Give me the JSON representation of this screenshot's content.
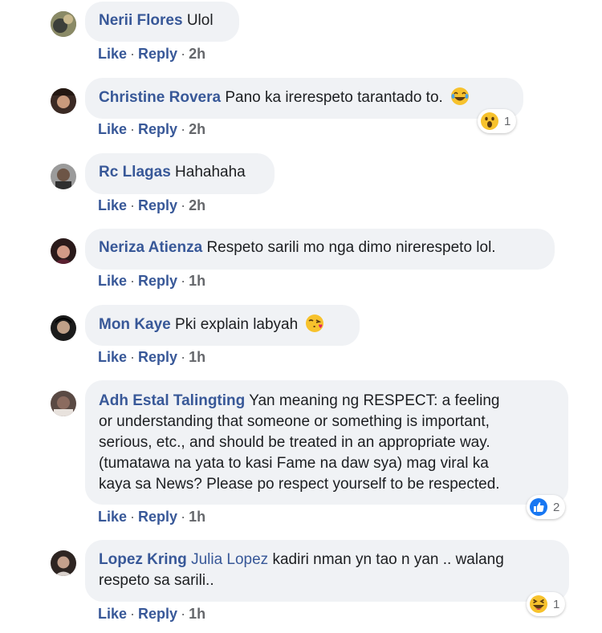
{
  "comments": [
    {
      "author": "Nerii Flores",
      "text": "Ulol",
      "like": "Like",
      "reply": "Reply",
      "time": "2h"
    },
    {
      "author": "Christine Rovera",
      "text": "Pano ka irerespeto tarantado to.",
      "emoji": "laughing-tears-emoji",
      "like": "Like",
      "reply": "Reply",
      "time": "2h",
      "reaction": {
        "icon": "wow-reaction-icon",
        "count": "1"
      }
    },
    {
      "author": "Rc Llagas",
      "text": "Hahahaha",
      "like": "Like",
      "reply": "Reply",
      "time": "2h"
    },
    {
      "author": "Neriza Atienza",
      "text": "Respeto sarili mo nga dimo nirerespeto lol.",
      "like": "Like",
      "reply": "Reply",
      "time": "1h"
    },
    {
      "author": "Mon Kaye",
      "text": "Pki explain labyah",
      "emoji": "kissing-heart-emoji",
      "like": "Like",
      "reply": "Reply",
      "time": "1h"
    },
    {
      "author": "Adh Estal Talingting",
      "text_lines": [
        "Yan meaning ng RESPECT: a feeling",
        "or understanding that someone or something is important,",
        "serious, etc., and should be treated in an appropriate way.",
        "(tumatawa na yata to kasi Fame na daw sya) mag viral ka",
        "kaya sa News? Please po respect yourself to be respected."
      ],
      "like": "Like",
      "reply": "Reply",
      "time": "1h",
      "reaction": {
        "icon": "like-reaction-icon",
        "count": "2"
      }
    },
    {
      "author": "Lopez Kring",
      "mention": "Julia Lopez",
      "text_lines": [
        "kadiri nman yn tao n yan .. walang",
        "respeto sa sarili.."
      ],
      "like": "Like",
      "reply": "Reply",
      "time": "1h",
      "reaction": {
        "icon": "haha-reaction-icon",
        "count": "1"
      }
    }
  ],
  "colors": {
    "name": "#385898",
    "bubble": "#f0f2f5",
    "text": "#1c1e21",
    "meta": "#65676b",
    "like_blue": "#1877f2",
    "emoji_yellow": "#f7c22d"
  }
}
